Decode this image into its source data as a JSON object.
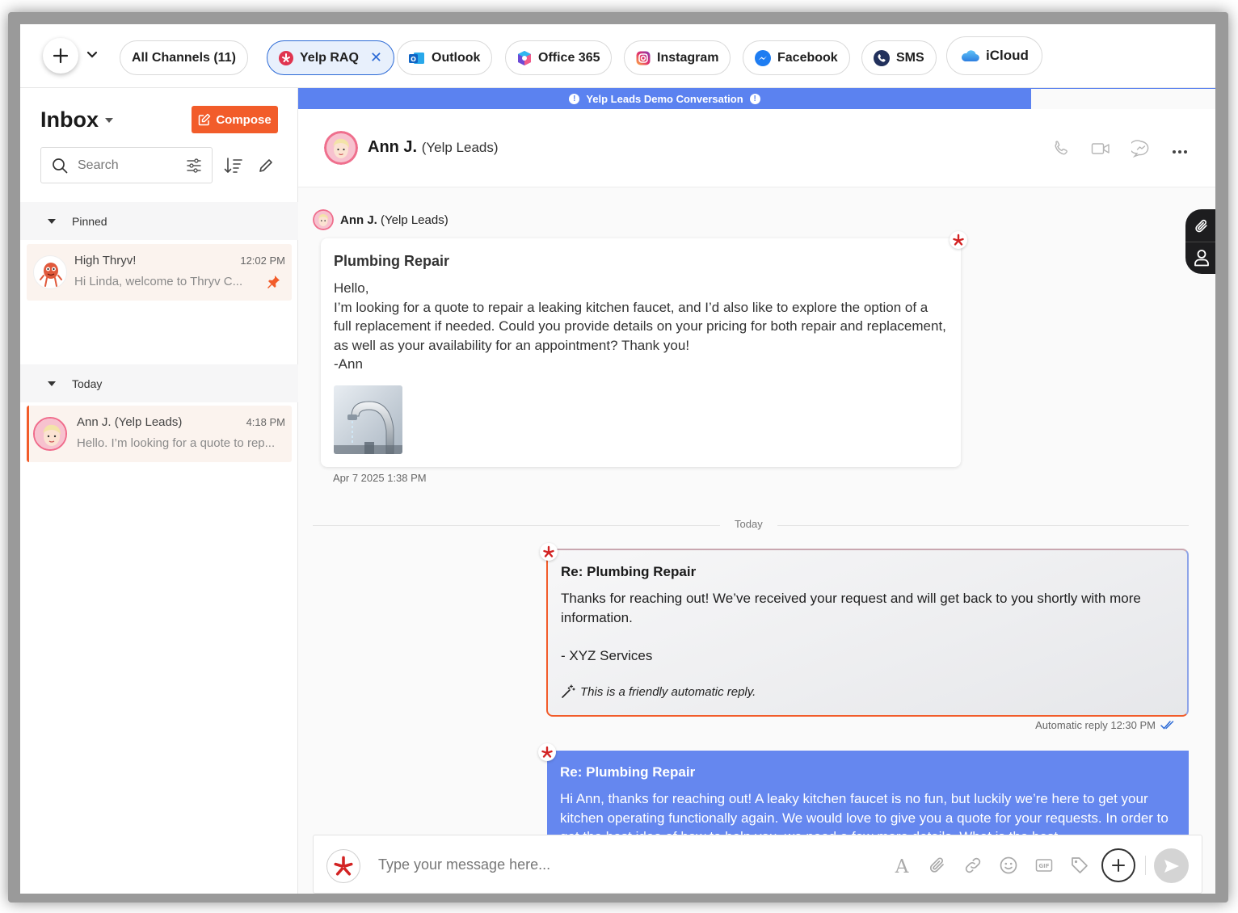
{
  "channels": {
    "all_label": "All Channels (11)",
    "items": [
      {
        "label": "Yelp RAQ",
        "icon": "yelp-icon",
        "active": true
      },
      {
        "label": "Outlook",
        "icon": "outlook-icon"
      },
      {
        "label": "Office 365",
        "icon": "office365-icon"
      },
      {
        "label": "Instagram",
        "icon": "instagram-icon"
      },
      {
        "label": "Facebook",
        "icon": "messenger-icon"
      },
      {
        "label": "SMS",
        "icon": "phone-icon"
      },
      {
        "label": "iCloud",
        "icon": "icloud-icon"
      }
    ]
  },
  "sidebar": {
    "title": "Inbox",
    "compose_label": "Compose",
    "search_placeholder": "Search",
    "sections": [
      {
        "label": "Pinned",
        "conversations": [
          {
            "name": "High Thryv!",
            "time": "12:02 PM",
            "preview": "Hi Linda, welcome to Thryv C...",
            "pinned": true
          }
        ]
      },
      {
        "label": "Today",
        "conversations": [
          {
            "name": "Ann J.  (Yelp Leads)",
            "time": "4:18 PM",
            "preview": "Hello. I’m looking for a quote to rep...",
            "selected": true
          }
        ]
      }
    ]
  },
  "main": {
    "banner": "Yelp Leads Demo Conversation",
    "contact_name": "Ann J.",
    "contact_source": "(Yelp Leads)",
    "incoming": {
      "sender_name": "Ann J.",
      "sender_source": "(Yelp Leads)",
      "subject": "Plumbing Repair",
      "greeting": "Hello,",
      "body": "I’m looking for a quote to repair a leaking kitchen faucet, and I’d also like to explore the option of a full replacement if needed. Could you provide details on your pricing for both repair and replacement, as well as your availability for an appointment? Thank you!",
      "signoff": "-Ann",
      "timestamp": "Apr 7 2025 1:38 PM"
    },
    "divider_label": "Today",
    "auto_reply": {
      "subject": "Re: Plumbing Repair",
      "body": "Thanks for reaching out! We’ve received your request and will get back to you shortly with more information.\n\n- XYZ Services",
      "note": "This is a friendly automatic reply.",
      "meta": "Automatic reply 12:30 PM"
    },
    "reply": {
      "subject": "Re: Plumbing Repair",
      "body": "Hi Ann, thanks for reaching out! A leaky kitchen faucet is no fun, but luckily we’re here to get your kitchen operating functionally again. We would love to give you a quote for your requests. In order to get the best idea of how to help you, we need a few more details. What is the best"
    },
    "composer_placeholder": "Type your message here..."
  },
  "colors": {
    "accent_orange": "#f25c2a",
    "accent_blue": "#5b82f0",
    "yelp_red": "#d32323"
  }
}
